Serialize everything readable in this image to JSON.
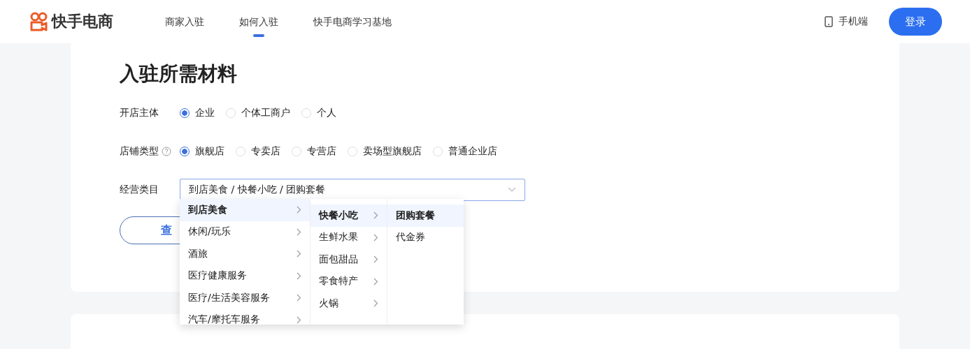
{
  "header": {
    "logo": "快手电商",
    "nav": [
      {
        "label": "商家入驻",
        "selected": false
      },
      {
        "label": "如何入驻",
        "selected": true
      },
      {
        "label": "快手电商学习基地",
        "selected": false
      }
    ],
    "mobile_link": "手机端",
    "login_button": "登录"
  },
  "section": {
    "title": "入驻所需材料",
    "fields": [
      {
        "kind": "radio",
        "label": "开店主体",
        "help": false,
        "options": [
          {
            "label": "企业",
            "selected": true
          },
          {
            "label": "个体工商户",
            "selected": false
          },
          {
            "label": "个人",
            "selected": false
          }
        ]
      },
      {
        "kind": "radio",
        "label": "店铺类型",
        "help": true,
        "options": [
          {
            "label": "旗舰店",
            "selected": true
          },
          {
            "label": "专卖店",
            "selected": false
          },
          {
            "label": "专营店",
            "selected": false
          },
          {
            "label": "卖场型旗舰店",
            "selected": false
          },
          {
            "label": "普通企业店",
            "selected": false
          }
        ]
      },
      {
        "kind": "select",
        "label": "经营类目",
        "value": "到店美食 / 快餐小吃 / 团购套餐"
      }
    ],
    "query_button": "查",
    "cascader": [
      [
        {
          "label": "到店美食",
          "selected": true,
          "expandable": true
        },
        {
          "label": "休闲/玩乐",
          "selected": false,
          "expandable": true
        },
        {
          "label": "酒旅",
          "selected": false,
          "expandable": true
        },
        {
          "label": "医疗健康服务",
          "selected": false,
          "expandable": true
        },
        {
          "label": "医疗/生活美容服务",
          "selected": false,
          "expandable": true
        },
        {
          "label": "汽车/摩托车服务",
          "selected": false,
          "expandable": true
        }
      ],
      [
        {
          "label": "快餐小吃",
          "selected": true,
          "expandable": true
        },
        {
          "label": "生鲜水果",
          "selected": false,
          "expandable": true
        },
        {
          "label": "面包甜品",
          "selected": false,
          "expandable": true
        },
        {
          "label": "零食特产",
          "selected": false,
          "expandable": true
        },
        {
          "label": "火锅",
          "selected": false,
          "expandable": true
        }
      ],
      [
        {
          "label": "团购套餐",
          "selected": true,
          "expandable": false
        },
        {
          "label": "代金券",
          "selected": false,
          "expandable": false
        }
      ]
    ]
  }
}
